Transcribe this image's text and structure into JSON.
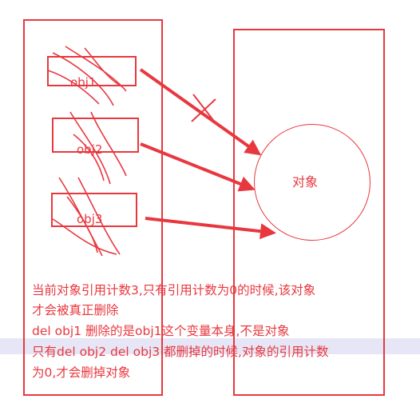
{
  "references": [
    {
      "id": "obj1",
      "label": "obj1"
    },
    {
      "id": "obj2",
      "label": "obj2"
    },
    {
      "id": "obj3",
      "label": "obj3"
    }
  ],
  "object": {
    "label": "对象"
  },
  "notes": {
    "line1": "当前对象引用计数3,只有引用计数为0的时候,该对象",
    "line2": "才会被真正删除",
    "line3": "del obj1   删除的是obj1这个变量本身,不是对象",
    "line4": "只有del obj2  del obj3 都删掉的时候,对象的引用计数",
    "line5": "为0,才会删掉对象"
  },
  "colors": {
    "accent": "#e8383f",
    "highlight": "#e6e6f6"
  }
}
